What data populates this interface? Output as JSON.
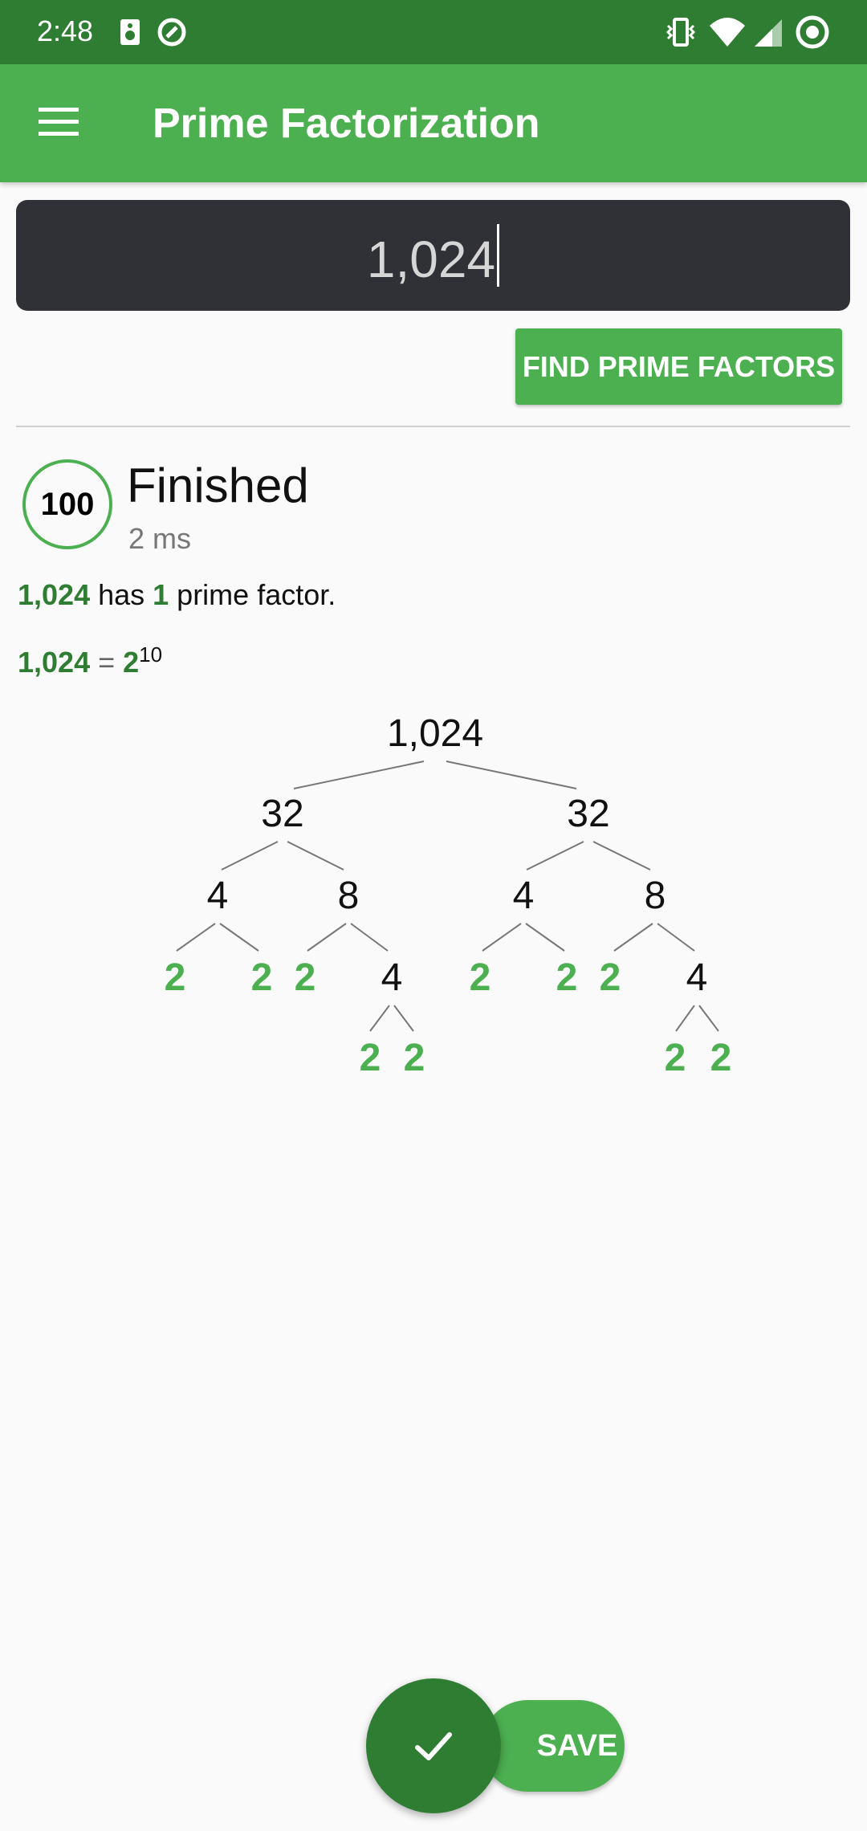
{
  "status_bar": {
    "time": "2:48",
    "left_icons": [
      "speaker-icon",
      "at-sign-icon"
    ],
    "right_icons": [
      "vibrate-icon",
      "wifi-icon",
      "signal-icon",
      "record-icon"
    ]
  },
  "app_bar": {
    "title": "Prime Factorization",
    "menu_icon": "hamburger-menu-icon"
  },
  "input": {
    "value": "1,024"
  },
  "find_button": {
    "label": "FIND PRIME FACTORS"
  },
  "result": {
    "progress": "100",
    "status_title": "Finished",
    "status_subtitle": "2 ms",
    "summary_number": "1,024",
    "summary_text_1": " has ",
    "summary_count": "1",
    "summary_text_2": " prime factor.",
    "eq_number": "1,024",
    "eq_sign": " = ",
    "eq_base": "2",
    "eq_exponent": "10"
  },
  "tree": {
    "root": "1,024",
    "level1": [
      "32",
      "32"
    ],
    "level2": [
      "4",
      "8",
      "4",
      "8"
    ],
    "level3": [
      "2",
      "2",
      "2",
      "4",
      "2",
      "2",
      "2",
      "4"
    ],
    "level4": [
      "2",
      "2",
      "2",
      "2"
    ]
  },
  "fab": {
    "save_label": "SAVE",
    "check_icon": "check-icon"
  },
  "colors": {
    "status_bar": "#2e7d32",
    "app_bar": "#4caf50",
    "prime": "#4caf50",
    "fab": "#2e7d32"
  }
}
